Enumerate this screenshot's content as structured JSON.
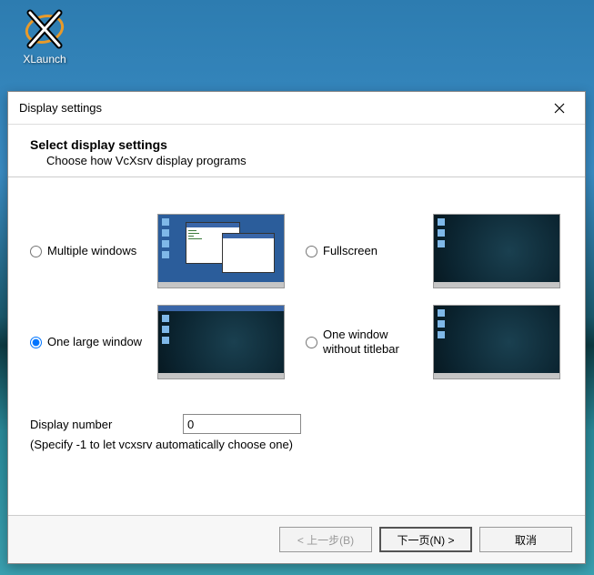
{
  "desktop": {
    "icon_label": "XLaunch"
  },
  "dialog": {
    "title": "Display settings",
    "header_title": "Select display settings",
    "header_subtitle": "Choose how VcXsrv display programs",
    "options": {
      "multiple_windows": "Multiple windows",
      "fullscreen": "Fullscreen",
      "one_large_window": "One large window",
      "one_window_no_titlebar": "One window without titlebar"
    },
    "selected_option": "one_large_window",
    "display_number_label": "Display number",
    "display_number_value": "0",
    "display_number_hint": "(Specify -1 to let vcxsrv automatically choose one)"
  },
  "buttons": {
    "back": "< 上一步(B)",
    "next": "下一页(N) >",
    "cancel": "取消"
  }
}
